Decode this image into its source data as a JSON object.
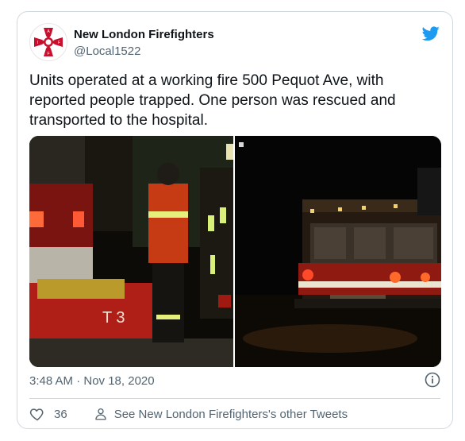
{
  "account": {
    "name": "New London Firefighters",
    "handle": "@Local1522",
    "avatar_icon": "iaff-maltese-cross-logo",
    "avatar_letters": "I A F F"
  },
  "tweet": {
    "text": "Units operated at a working fire 500 Pequot Ave, with reported people trapped. One person was rescued and transported to the hospital.",
    "timestamp": "3:48 AM · Nov 18, 2020"
  },
  "media": {
    "photo_left_label": "T 3"
  },
  "actions": {
    "like_count": "36",
    "see_more": "See New London Firefighters's other Tweets"
  },
  "colors": {
    "brand": "#1d9bf0",
    "text": "#0f1419",
    "secondary": "#536471",
    "border": "#cfd9de",
    "logo_red": "#c8102e"
  },
  "icons": [
    "twitter-bird-icon",
    "info-icon",
    "heart-icon",
    "person-icon"
  ]
}
